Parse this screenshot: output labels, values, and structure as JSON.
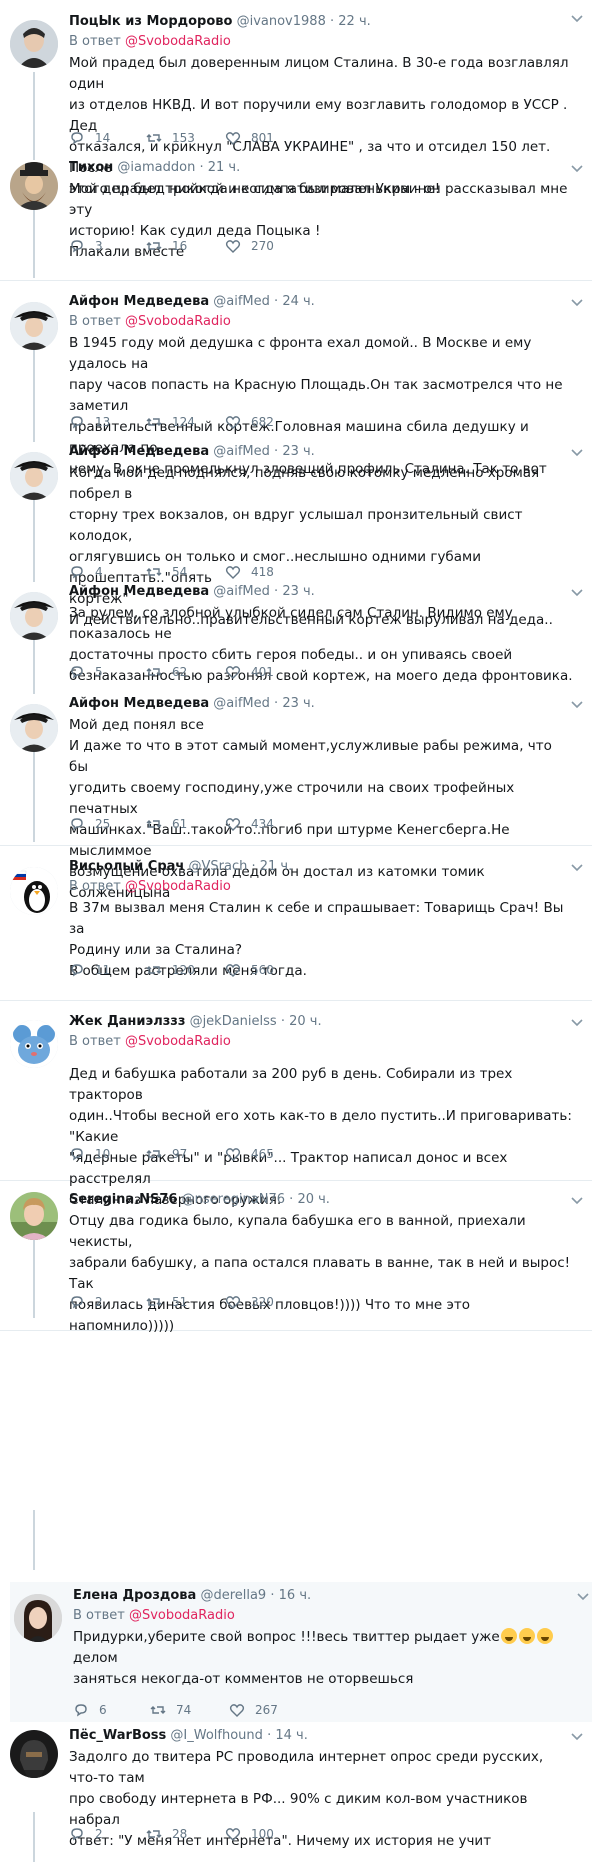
{
  "reply_to_prefix": "В ответ ",
  "tweets": [
    {
      "name": "ПоцЫк из Мордорово",
      "handle": "@ivanov1988",
      "time": "22 ч.",
      "reply_to": "@SvobodaRadio",
      "text": "Мой прадед был доверенным лицом Сталина. В 30-е года возглавлял один\nиз отделов НКВД.  И вот поручили ему возглавить голодомор в УССР .  Дед\nотказался,  и крикнул \"СЛАВА  УКРАИНЕ\" , за что и отсидел 150 лет.  После\nэтого прадед никогда не симпатизировал Украине!",
      "replies": "14",
      "retweets": "153",
      "likes": "801",
      "avatar": "portrait-dark"
    },
    {
      "name": "Тихон",
      "handle": "@iamaddon",
      "time": "21 ч.",
      "reply_to": "",
      "text": "Мой дед был тройкой и когда я был маленьким - он рассказывал мне эту\nисторию! Как судил деда Поцыка !\nПлакали вместе",
      "replies": "3",
      "retweets": "16",
      "likes": "270",
      "avatar": "bearded-man-hat"
    },
    {
      "name": "Айфон Медведева",
      "handle": "@aifMed",
      "time": "24 ч.",
      "reply_to": "@SvobodaRadio",
      "text": "В 1945 году мой дедушка  с фронта ехал домой.. В Москве и ему удалось  на\nпару часов попасть на Красную Площадь.Он так засмотрелся  что не заметил\nправительственный кортеж.Головная машина сбила дедушку и проехала по\nнему. В окне промелькнул зловещий профиль Сталина. Так то вот",
      "replies": "13",
      "retweets": "124",
      "likes": "682",
      "avatar": "man-tricorn-hat"
    },
    {
      "name": "Айфон Медведева",
      "handle": "@aifMed",
      "time": "23 ч.",
      "reply_to": "",
      "text": "Когда мой дед поднялся, подняв свою котомку медленно хромая побрел в\nсторну трех вокзалов, он вдруг услышал пронзительный свист колодок,\nоглягувшись он только и смог..неслышно одними губами прошептать..\"опять\nкортеж\"\n  И действительно..правительственный кортеж выруливал на деда..",
      "replies": "4",
      "retweets": "54",
      "likes": "418",
      "avatar": "man-tricorn-hat"
    },
    {
      "name": "Айфон Медведева",
      "handle": "@aifMed",
      "time": "23 ч.",
      "reply_to": "",
      "text": "За рулем, со злобной улыбкой сидел сам Сталин. Видимо ему показалось не\nдостаточны просто сбить героя победы.. и он упиваясь своей\nбезнаказанностью разгонял свой кортеж, на моего деда фронтовика.",
      "replies": "5",
      "retweets": "62",
      "likes": "401",
      "avatar": "man-tricorn-hat"
    },
    {
      "name": "Айфон Медведева",
      "handle": "@aifMed",
      "time": "23 ч.",
      "reply_to": "",
      "text": "Мой дед понял все\nИ даже то что в этот самый момент,услужливые рабы режима, что бы\nугодить своему господину,уже строчили на своих трофейных печатных\nмашинках.\"Ваш..такой то..погиб при штурме Кенегсберга.Не мыслиммое\nвозмущение охватила дедом он достал из катомки томик Солженицына",
      "replies": "25",
      "retweets": "61",
      "likes": "434",
      "avatar": "man-tricorn-hat"
    },
    {
      "name": "Висьолый Срач",
      "handle": "@VSrach",
      "time": "21 ч.",
      "reply_to": "@SvobodaRadio",
      "text": "В 37м вызвал меня Сталин к себе и спрашывает: Товарищь Срач! Вы за\nРодину или за Сталина?\nВ общем растреляли меня тогда.",
      "replies": "11",
      "retweets": "120",
      "likes": "560",
      "avatar": "penguin-flag"
    },
    {
      "name": "Жек Даниэлззз",
      "handle": "@jekDanielss",
      "time": "20 ч.",
      "reply_to": "@SvobodaRadio",
      "text": "Дед и бабушка работали за 200 руб в день. Собирали из трех  тракторов\nодин..Чтобы весной его хоть как-то в дело пустить..И приговаривать: \"Какие\n\"ядерные ракеты\" и \"рывки\"... Трактор написал донос и всех расстрелял\nСталин из лазерного оружия.",
      "replies": "10",
      "retweets": "97",
      "likes": "465",
      "avatar": "blue-mouse"
    },
    {
      "name": "Seregina.NS76",
      "handle": "@nsereginaN76",
      "time": "20 ч.",
      "reply_to": "",
      "text": "Отцу два годика было, купала бабушка его в ванной, приехали чекисты,\nзабрали бабушку, а папа остался плавать в ванне, так в ней и вырос! Так\nпоявилась династия боевых пловцов!)))) Что то мне это напомнило)))))",
      "replies": "2",
      "retweets": "51",
      "likes": "320",
      "avatar": "woman-photo"
    },
    {
      "name": "Елена Дроздова",
      "handle": "@derella9",
      "time": "16 ч.",
      "reply_to": "@SvobodaRadio",
      "text_before": "Придурки,уберите свой вопрос !!!весь твиттер рыдает уже",
      "text_after": "делом\nзаняться некогда-от комментов не оторвешься",
      "emoji": "grinning-sweat-face",
      "replies": "6",
      "retweets": "74",
      "likes": "267",
      "avatar": "woman-dark-hair"
    },
    {
      "name": "Пёс_WarBoss",
      "handle": "@I_Wolfhound",
      "time": "14 ч.",
      "reply_to": "",
      "text": "Задолго до твитера РС проводила интернет опрос среди русских, что-то там\nпро свободу интернета в РФ... 90% с диким кол-вом участников набрал\nответ: \"У меня нет интернета\". Ничему их история не учит",
      "replies": "2",
      "retweets": "28",
      "likes": "100",
      "avatar": "dark-helmet"
    }
  ]
}
